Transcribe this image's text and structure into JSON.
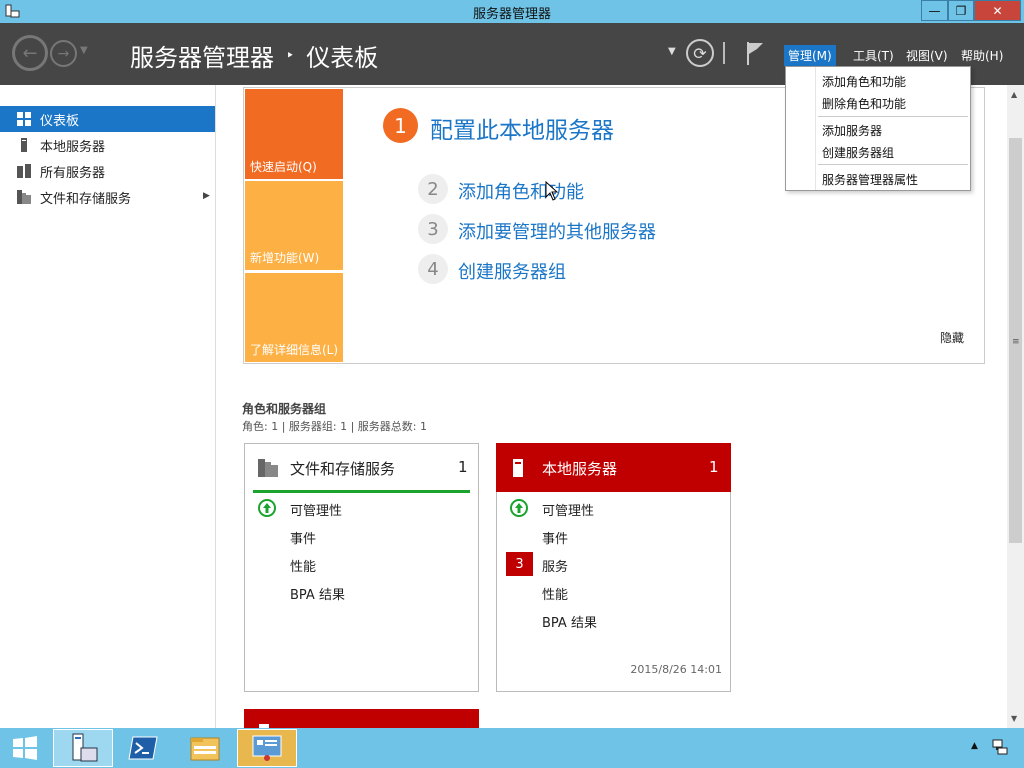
{
  "window": {
    "title": "服务器管理器",
    "min": "—",
    "max": "❐",
    "close": "✕"
  },
  "header": {
    "breadcrumb_root": "服务器管理器",
    "breadcrumb_sep": "‣",
    "breadcrumb_page": "仪表板"
  },
  "menu": {
    "manage": "管理(M)",
    "tools": "工具(T)",
    "view": "视图(V)",
    "help": "帮助(H)"
  },
  "dropdown": {
    "items": [
      "添加角色和功能",
      "删除角色和功能",
      "添加服务器",
      "创建服务器组",
      "服务器管理器属性"
    ]
  },
  "sidebar": {
    "items": [
      {
        "label": "仪表板",
        "icon": "dashboard-icon"
      },
      {
        "label": "本地服务器",
        "icon": "server-icon"
      },
      {
        "label": "所有服务器",
        "icon": "servers-icon"
      },
      {
        "label": "文件和存储服务",
        "icon": "storage-icon"
      }
    ],
    "expand_arrow": "▶"
  },
  "quickstart": {
    "tiles": [
      "快速启动(Q)",
      "新增功能(W)",
      "了解详细信息(L)"
    ],
    "step1_num": "1",
    "step1_text": "配置此本地服务器",
    "steps": [
      {
        "num": "2",
        "text": "添加角色和功能"
      },
      {
        "num": "3",
        "text": "添加要管理的其他服务器"
      },
      {
        "num": "4",
        "text": "创建服务器组"
      }
    ],
    "hide": "隐藏"
  },
  "roles": {
    "title": "角色和服务器组",
    "subtitle": "角色: 1 | 服务器组: 1 | 服务器总数: 1"
  },
  "cards": [
    {
      "title": "文件和存储服务",
      "count": "1",
      "rows": [
        "可管理性",
        "事件",
        "性能",
        "BPA 结果"
      ]
    },
    {
      "title": "本地服务器",
      "count": "1",
      "rows": [
        "可管理性",
        "事件",
        "服务",
        "性能",
        "BPA 结果"
      ],
      "services_badge": "3",
      "timestamp": "2015/8/26 14:01"
    }
  ],
  "colors": {
    "accent": "#1b76c7",
    "orange": "#f26b22",
    "amber": "#fdb145",
    "alert": "#c00000",
    "ok": "#1aa32d"
  },
  "taskbar": {
    "items": [
      "start-icon",
      "server-manager-icon",
      "powershell-icon",
      "file-explorer-icon",
      "control-panel-icon"
    ]
  }
}
